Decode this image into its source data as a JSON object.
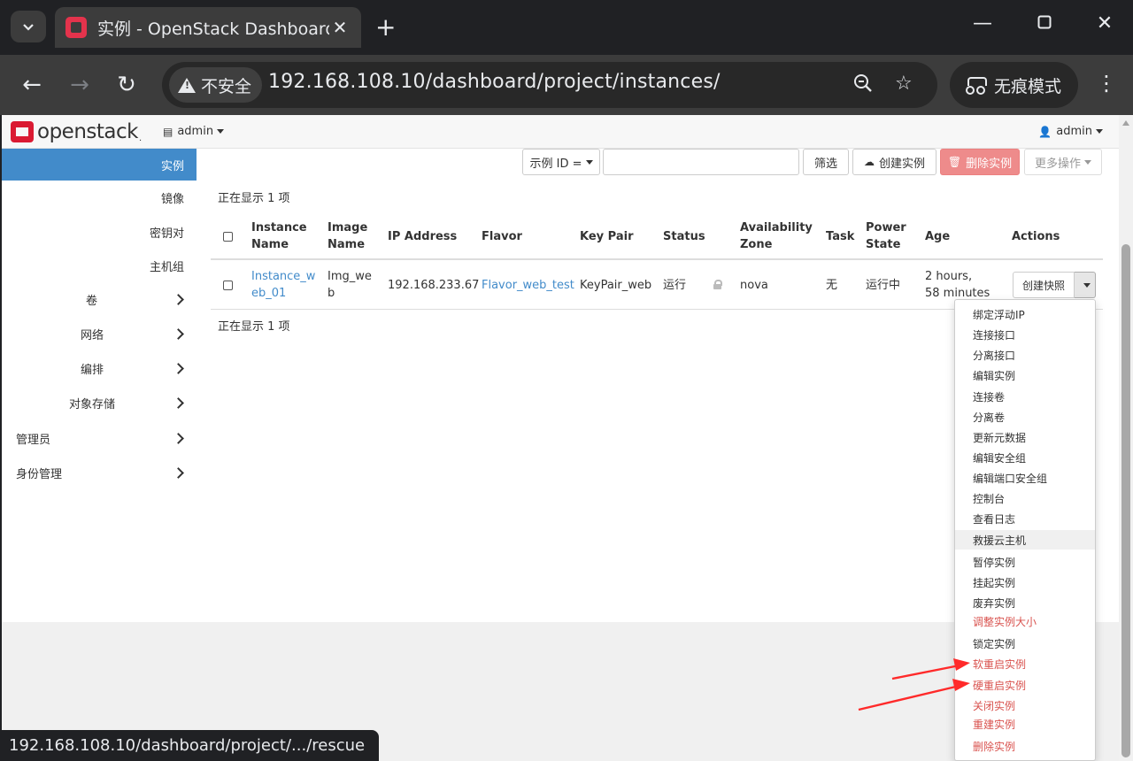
{
  "browser": {
    "tab_title": "实例 - OpenStack Dashboard",
    "insecure_label": "不安全",
    "url": "192.168.108.10/dashboard/project/instances/",
    "incognito_label": "无痕模式",
    "status_url": "192.168.108.10/dashboard/project/.../rescue"
  },
  "os": {
    "logo_text": "openstack",
    "project": "admin",
    "user": "admin"
  },
  "sidebar": {
    "sub_items": [
      "实例",
      "镜像",
      "密钥对",
      "主机组"
    ],
    "groups": [
      "卷",
      "网络",
      "编排",
      "对象存储"
    ],
    "top_groups": [
      "管理员",
      "身份管理"
    ]
  },
  "filters": {
    "select_label": "示例 ID =",
    "filter_button": "筛选",
    "create_button": "创建实例",
    "delete_button": "删除实例",
    "more_button": "更多操作"
  },
  "table": {
    "count_text": "正在显示 1 项",
    "headers": {
      "name_1": "Instance",
      "name_2": "Name",
      "image_1": "Image",
      "image_2": "Name",
      "ip": "IP Address",
      "flavor": "Flavor",
      "keypair": "Key Pair",
      "status": "Status",
      "az_1": "Availability",
      "az_2": "Zone",
      "task": "Task",
      "power_1": "Power",
      "power_2": "State",
      "age": "Age",
      "actions": "Actions"
    },
    "row": {
      "name_1": "Instance_w",
      "name_2": "eb_01",
      "image_1": "Img_we",
      "image_2": "b",
      "ip": "192.168.233.67",
      "flavor": "Flavor_web_test",
      "keypair": "KeyPair_web",
      "status": "运行",
      "az": "nova",
      "task": "无",
      "power": "运行中",
      "age_1": "2 hours,",
      "age_2": "58 minutes",
      "action_button": "创建快照"
    }
  },
  "dropdown": {
    "items": [
      "绑定浮动IP",
      "连接接口",
      "分离接口",
      "编辑实例",
      "连接卷",
      "分离卷",
      "更新元数据",
      "编辑安全组",
      "编辑端口安全组",
      "控制台",
      "查看日志",
      "救援云主机",
      "暂停实例",
      "挂起实例",
      "废弃实例",
      "调整实例大小",
      "锁定实例",
      "软重启实例",
      "硬重启实例",
      "关闭实例",
      "重建实例",
      "删除实例"
    ],
    "danger_color": "#d9534f"
  },
  "colors": {
    "accent": "#428bca",
    "brand": "#da1a32",
    "annotation_arrow": "#ff2a2a"
  }
}
